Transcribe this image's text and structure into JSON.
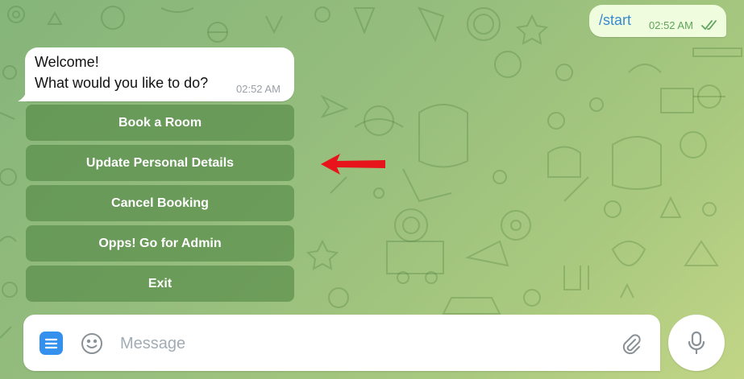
{
  "outgoing": {
    "text": "/start",
    "time": "02:52 AM",
    "status_icon": "double-check-icon"
  },
  "incoming": {
    "line1": "Welcome!",
    "line2": "What would you like to do?",
    "time": "02:52 AM"
  },
  "keyboard": {
    "buttons": [
      {
        "label": "Book a Room"
      },
      {
        "label": "Update Personal Details"
      },
      {
        "label": "Cancel Booking"
      },
      {
        "label": "Opps! Go for Admin"
      },
      {
        "label": "Exit"
      }
    ]
  },
  "annotation": {
    "icon": "red-arrow-icon",
    "color": "#e8141c",
    "points_to": "Update Personal Details"
  },
  "composer": {
    "placeholder": "Message",
    "value": "",
    "icons": [
      "menu-icon",
      "emoji-icon",
      "attach-icon",
      "mic-icon"
    ]
  },
  "colors": {
    "accent": "#3390ec",
    "outgoing_bubble": "#effdde",
    "keyboard_button": "#5f9a4f",
    "background": "#95bd7d"
  }
}
